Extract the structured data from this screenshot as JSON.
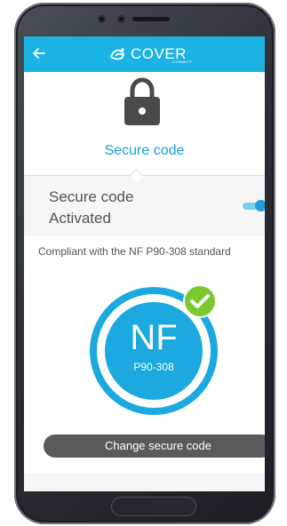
{
  "header": {
    "back_icon": "arrow-left-icon",
    "brand_name": "COVER",
    "brand_sub": "CONNECT",
    "logo_icon": "cover-connect-logo",
    "accent_color": "#1bb3e3"
  },
  "section": {
    "icon": "lock-icon",
    "title": "Secure code"
  },
  "status": {
    "label": "Secure code Activated",
    "toggle_on": true
  },
  "compliance": {
    "text": "Compliant with the NF P90-308 standard"
  },
  "badge": {
    "big": "NF",
    "small": "P90-308",
    "check_icon": "check-icon",
    "check_color": "#7bc92f"
  },
  "actions": {
    "change_label": "Change secure code"
  }
}
